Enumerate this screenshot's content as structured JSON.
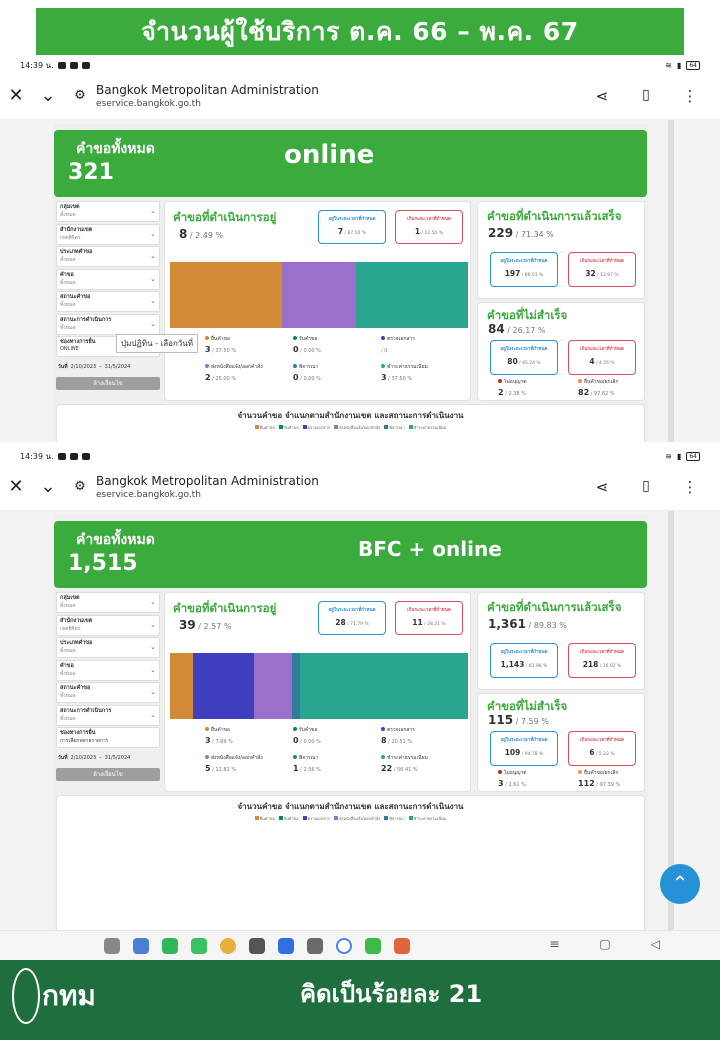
{
  "banner": {
    "title": "จำนวนผู้ใช้บริการ  ต.ค. 66 – พ.ค. 67"
  },
  "status": {
    "time": "14:39 น.",
    "battery": "64"
  },
  "browser": {
    "title": "Bangkok Metropolitan Administration",
    "url": "eservice.bangkok.go.th"
  },
  "labels": {
    "total": "คำขอทั้งหมด",
    "in_progress": "คำขอที่ดำเนินการอยู่",
    "done": "คำขอที่ดำเนินการแล้วเสร็จ",
    "failed": "คำขอที่ไม่สำเร็จ",
    "within": "อยู่ในระยะเวลาที่กำหนด",
    "over": "เกินระยะเวลาที่กำหนด",
    "no_permit": "ไม่อนุญาต",
    "cancelled": "ยื่นคำขอ/ยกเลิก",
    "btn": "ล้างเงื่อนไข",
    "date_label": "วันที่",
    "chart_title": "จำนวนคำขอ  จำแนกตามสำนักงานเขต และสถานะการดำเนินงาน"
  },
  "filters": [
    {
      "label": "กลุ่มเขต",
      "value": "ทั้งหมด"
    },
    {
      "label": "สำนักงานเขต",
      "value": "เขตพิจิตร"
    },
    {
      "label": "ประเภทคำขอ",
      "value": "ทั้งหมด"
    },
    {
      "label": "คำขอ",
      "value": "ทั้งหมด"
    },
    {
      "label": "สถานะคำขอ",
      "value": "ทั้งหมด"
    },
    {
      "label": "สถานะการดำเนินการ",
      "value": "ทั้งหมด"
    }
  ],
  "channel_label": "ช่องทางการยื่น",
  "shot1": {
    "tag": "online",
    "total": "321",
    "channel_value": "ONLINE",
    "tooltip": "ปุ่มปฏิทิน - เลือกวันที่",
    "date_from": "2/10/2023",
    "date_to": "31/5/2024",
    "in_progress": {
      "num": "8",
      "pct": " / 2.49 %",
      "within": "7",
      "within_pct": " / 87.50 %",
      "over": "1",
      "over_pct": " / 12.50 %"
    },
    "bar": [
      {
        "color": "#d18a35",
        "value": 3
      },
      {
        "color": "#9b70cc",
        "value": 2
      },
      {
        "color": "#2aa58f",
        "value": 3
      }
    ],
    "legend": [
      {
        "label": "ยื่นคำขอ",
        "color": "#d18a35",
        "value": "3",
        "pct": " / 37.50 %"
      },
      {
        "label": "รับคำขอ",
        "color": "#00897b",
        "value": "0",
        "pct": " / 0.00 %"
      },
      {
        "label": "ตรวจเอกสาร",
        "color": "#3f3fbf",
        "value": "",
        "pct": " / 0"
      },
      {
        "label": "ส่งหนังสือแจ้ง/ออกคำสั่ง",
        "color": "#9b70cc",
        "value": "2",
        "pct": " / 25.00 %"
      },
      {
        "label": "พิจารณา",
        "color": "#2e7d9a",
        "value": "0",
        "pct": " / 0.00 %"
      },
      {
        "label": "ชำระค่าธรรมเนียม",
        "color": "#2aa58f",
        "value": "3",
        "pct": " / 37.50 %"
      }
    ],
    "done": {
      "num": "229",
      "pct": " / 71.34 %",
      "within": "197",
      "within_pct": " / 86.03 %",
      "over": "32",
      "over_pct": " / 13.97 %"
    },
    "failed": {
      "num": "84",
      "pct": " / 26.17 %",
      "within": "80",
      "within_pct": " / 95.24 %",
      "over": "4",
      "over_pct": " / 4.76 %",
      "no_permit": "2",
      "no_permit_pct": " / 2.38 %",
      "cancelled": "82",
      "cancelled_pct": " / 97.62 %"
    }
  },
  "shot2": {
    "tag": "BFC + online",
    "total": "1,515",
    "channel_value": "การเลือกหลายรายการ",
    "date_from": "2/10/2023",
    "date_to": "31/5/2024",
    "in_progress": {
      "num": "39",
      "pct": " / 2.57 %",
      "within": "28",
      "within_pct": " / 71.79 %",
      "over": "11",
      "over_pct": " / 28.21 %"
    },
    "bar": [
      {
        "color": "#d18a35",
        "value": 3
      },
      {
        "color": "#3f3fbf",
        "value": 8
      },
      {
        "color": "#9b70cc",
        "value": 5
      },
      {
        "color": "#2e7d9a",
        "value": 1
      },
      {
        "color": "#2aa58f",
        "value": 22
      }
    ],
    "legend": [
      {
        "label": "ยื่นคำขอ",
        "color": "#d18a35",
        "value": "3",
        "pct": " / 7.69 %"
      },
      {
        "label": "รับคำขอ",
        "color": "#00897b",
        "value": "0",
        "pct": " / 0.00 %"
      },
      {
        "label": "ตรวจเอกสาร",
        "color": "#3f3fbf",
        "value": "8",
        "pct": " / 20.51 %"
      },
      {
        "label": "ส่งหนังสือแจ้ง/ออกคำสั่ง",
        "color": "#9b70cc",
        "value": "5",
        "pct": " / 12.82 %"
      },
      {
        "label": "พิจารณา",
        "color": "#2e7d9a",
        "value": "1",
        "pct": " / 2.56 %"
      },
      {
        "label": "ชำระค่าธรรมเนียม",
        "color": "#2aa58f",
        "value": "22",
        "pct": " / 56.41 %"
      }
    ],
    "done": {
      "num": "1,361",
      "pct": " / 89.83 %",
      "within": "1,143",
      "within_pct": " / 83.98 %",
      "over": "218",
      "over_pct": " / 16.02 %"
    },
    "failed": {
      "num": "115",
      "pct": " / 7.59 %",
      "within": "109",
      "within_pct": " / 94.78 %",
      "over": "6",
      "over_pct": " / 5.22 %",
      "no_permit": "3",
      "no_permit_pct": " / 2.61 %",
      "cancelled": "112",
      "cancelled_pct": " / 97.39 %"
    }
  },
  "footer": {
    "org": "กทม",
    "text": "คิดเป็นร้อยละ  21"
  }
}
